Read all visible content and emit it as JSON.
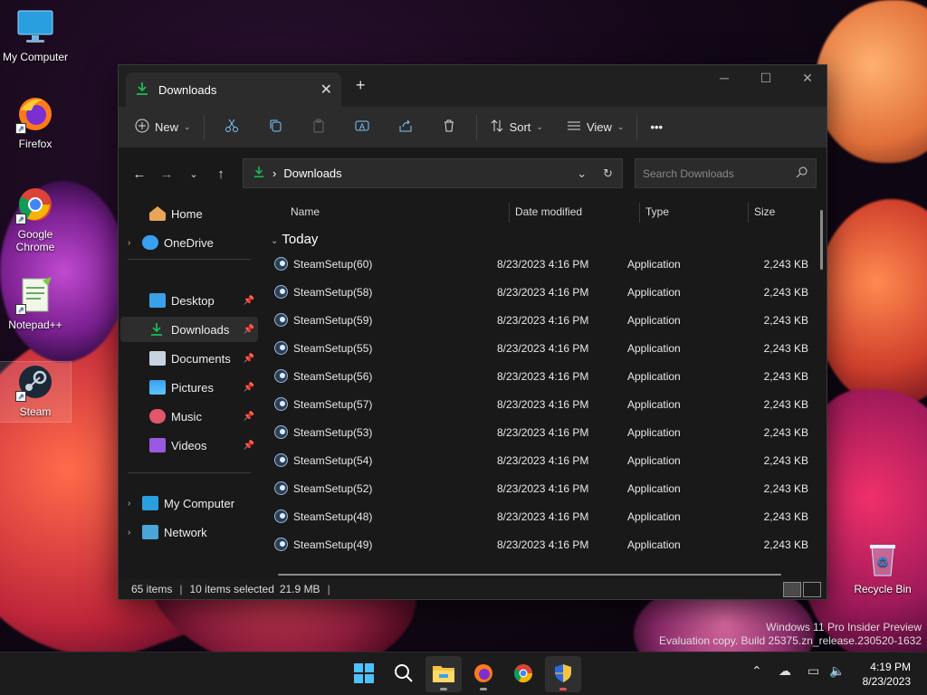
{
  "desktop": {
    "icons": [
      {
        "label": "My Computer",
        "icon": "monitor-icon"
      },
      {
        "label": "Firefox",
        "icon": "firefox-icon"
      },
      {
        "label": "Google Chrome",
        "icon": "chrome-icon"
      },
      {
        "label": "Notepad++",
        "icon": "notepadpp-icon"
      },
      {
        "label": "Steam",
        "icon": "steam-icon"
      },
      {
        "label": "Recycle Bin",
        "icon": "recycle-bin-icon"
      }
    ],
    "watermark": {
      "line1": "Windows 11 Pro Insider Preview",
      "line2": "Evaluation copy. Build 25375.zn_release.230520-1632"
    }
  },
  "window": {
    "tab_title": "Downloads",
    "toolbar": {
      "new_label": "New",
      "sort_label": "Sort",
      "view_label": "View",
      "more_label": "•••"
    },
    "address": {
      "crumb_separator": "›",
      "crumb": "Downloads",
      "search_placeholder": "Search Downloads"
    },
    "nav": {
      "home": "Home",
      "onedrive": "OneDrive",
      "desktop": "Desktop",
      "downloads": "Downloads",
      "documents": "Documents",
      "pictures": "Pictures",
      "music": "Music",
      "videos": "Videos",
      "mycomputer": "My Computer",
      "network": "Network"
    },
    "columns": {
      "name": "Name",
      "date": "Date modified",
      "type": "Type",
      "size": "Size"
    },
    "group_label": "Today",
    "files": [
      {
        "name": "SteamSetup(60)",
        "date": "8/23/2023 4:16 PM",
        "type": "Application",
        "size": "2,243 KB"
      },
      {
        "name": "SteamSetup(58)",
        "date": "8/23/2023 4:16 PM",
        "type": "Application",
        "size": "2,243 KB"
      },
      {
        "name": "SteamSetup(59)",
        "date": "8/23/2023 4:16 PM",
        "type": "Application",
        "size": "2,243 KB"
      },
      {
        "name": "SteamSetup(55)",
        "date": "8/23/2023 4:16 PM",
        "type": "Application",
        "size": "2,243 KB"
      },
      {
        "name": "SteamSetup(56)",
        "date": "8/23/2023 4:16 PM",
        "type": "Application",
        "size": "2,243 KB"
      },
      {
        "name": "SteamSetup(57)",
        "date": "8/23/2023 4:16 PM",
        "type": "Application",
        "size": "2,243 KB"
      },
      {
        "name": "SteamSetup(53)",
        "date": "8/23/2023 4:16 PM",
        "type": "Application",
        "size": "2,243 KB"
      },
      {
        "name": "SteamSetup(54)",
        "date": "8/23/2023 4:16 PM",
        "type": "Application",
        "size": "2,243 KB"
      },
      {
        "name": "SteamSetup(52)",
        "date": "8/23/2023 4:16 PM",
        "type": "Application",
        "size": "2,243 KB"
      },
      {
        "name": "SteamSetup(48)",
        "date": "8/23/2023 4:16 PM",
        "type": "Application",
        "size": "2,243 KB"
      },
      {
        "name": "SteamSetup(49)",
        "date": "8/23/2023 4:16 PM",
        "type": "Application",
        "size": "2,243 KB"
      }
    ],
    "status": {
      "items": "65 items",
      "selected": "10 items selected",
      "selected_size": "21.9 MB"
    }
  },
  "taskbar": {
    "clock_time": "4:19 PM",
    "clock_date": "8/23/2023"
  },
  "colors": {
    "accent": "#4cc2ff",
    "downloads_green": "#1db954",
    "window_bg": "#191919",
    "toolbar_bg": "#2c2c2c"
  }
}
